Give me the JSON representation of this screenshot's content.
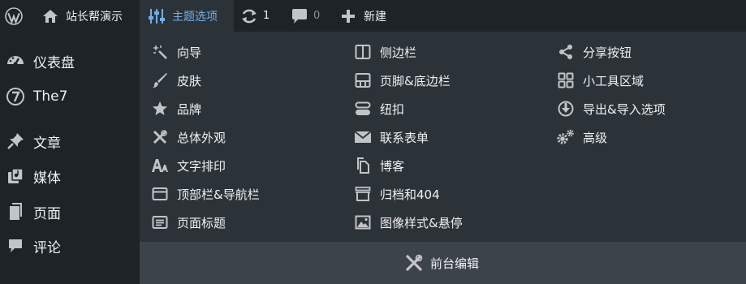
{
  "adminbar": {
    "site_name": "站长帮演示",
    "theme_options": "主题选项",
    "updates_count": "1",
    "comments_count": "0",
    "new_label": "新建",
    "accent_color": "#72aee6"
  },
  "sidebar": {
    "items": [
      {
        "label": "仪表盘",
        "icon": "dashboard-icon"
      },
      {
        "label": "The7",
        "icon": "the7-icon"
      },
      {
        "label": "文章",
        "icon": "pin-icon"
      },
      {
        "label": "媒体",
        "icon": "media-icon"
      },
      {
        "label": "页面",
        "icon": "page-icon"
      },
      {
        "label": "评论",
        "icon": "comment-icon"
      }
    ]
  },
  "menu": {
    "col1": [
      {
        "label": "向导",
        "icon": "wand-icon"
      },
      {
        "label": "皮肤",
        "icon": "brush-icon"
      },
      {
        "label": "品牌",
        "icon": "star-icon"
      },
      {
        "label": "总体外观",
        "icon": "tools-icon"
      },
      {
        "label": "文字排印",
        "icon": "typography-icon"
      },
      {
        "label": "顶部栏&导航栏",
        "icon": "window-icon"
      },
      {
        "label": "页面标题",
        "icon": "title-icon"
      }
    ],
    "col2": [
      {
        "label": "侧边栏",
        "icon": "sidebar-icon"
      },
      {
        "label": "页脚&底边栏",
        "icon": "footer-icon"
      },
      {
        "label": "纽扣",
        "icon": "button-icon"
      },
      {
        "label": "联系表单",
        "icon": "mail-icon"
      },
      {
        "label": "博客",
        "icon": "copy-icon"
      },
      {
        "label": "归档和404",
        "icon": "archive-icon"
      },
      {
        "label": "图像样式&悬停",
        "icon": "image-icon"
      }
    ],
    "col3": [
      {
        "label": "分享按钮",
        "icon": "share-icon"
      },
      {
        "label": "小工具区域",
        "icon": "widgets-icon"
      },
      {
        "label": "导出&导入选项",
        "icon": "download-icon"
      },
      {
        "label": "高级",
        "icon": "gears-icon"
      }
    ],
    "frontend_edit": "前台编辑"
  }
}
